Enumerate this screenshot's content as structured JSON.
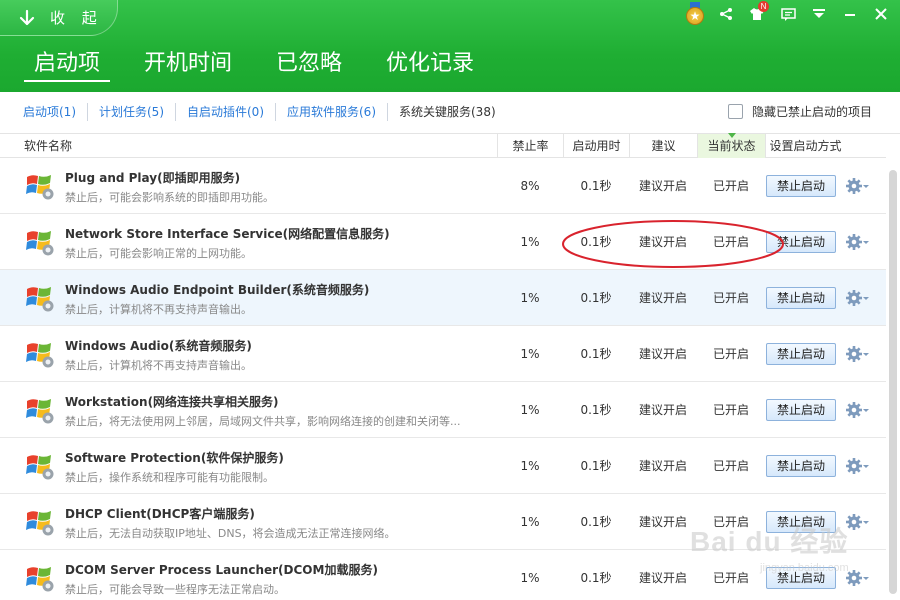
{
  "header": {
    "collapse_label": "收 起",
    "main_tabs": [
      {
        "label": "启动项"
      },
      {
        "label": "开机时间"
      },
      {
        "label": "已忽略"
      },
      {
        "label": "优化记录"
      }
    ],
    "notification_badge": "N",
    "accent_color": "#1fae33"
  },
  "subtabs": {
    "items": [
      {
        "label": "启动项(1)"
      },
      {
        "label": "计划任务(5)"
      },
      {
        "label": "自启动插件(0)"
      },
      {
        "label": "应用软件服务(6)"
      },
      {
        "label": "系统关键服务(38)"
      }
    ],
    "hide_disabled_label": "隐藏已禁止启动的项目"
  },
  "columns": {
    "name": "软件名称",
    "rate": "禁止率",
    "time": "启动用时",
    "advice": "建议",
    "status": "当前状态",
    "action": "设置启动方式"
  },
  "rows": [
    {
      "name": "Plug and Play(即插即用服务)",
      "desc": "禁止后，可能会影响系统的即插即用功能。",
      "rate": "8%",
      "time": "0.1秒",
      "advice": "建议开启",
      "status": "已开启",
      "action": "禁止启动"
    },
    {
      "name": "Network Store Interface Service(网络配置信息服务)",
      "desc": "禁止后，可能会影响正常的上网功能。",
      "rate": "1%",
      "time": "0.1秒",
      "advice": "建议开启",
      "status": "已开启",
      "action": "禁止启动"
    },
    {
      "name": "Windows Audio Endpoint Builder(系统音频服务)",
      "desc": "禁止后，计算机将不再支持声音输出。",
      "rate": "1%",
      "time": "0.1秒",
      "advice": "建议开启",
      "status": "已开启",
      "action": "禁止启动"
    },
    {
      "name": "Windows Audio(系统音频服务)",
      "desc": "禁止后，计算机将不再支持声音输出。",
      "rate": "1%",
      "time": "0.1秒",
      "advice": "建议开启",
      "status": "已开启",
      "action": "禁止启动"
    },
    {
      "name": "Workstation(网络连接共享相关服务)",
      "desc": "禁止后，将无法使用网上邻居，局域网文件共享，影响网络连接的创建和关闭等...",
      "rate": "1%",
      "time": "0.1秒",
      "advice": "建议开启",
      "status": "已开启",
      "action": "禁止启动"
    },
    {
      "name": "Software Protection(软件保护服务)",
      "desc": "禁止后，操作系统和程序可能有功能限制。",
      "rate": "1%",
      "time": "0.1秒",
      "advice": "建议开启",
      "status": "已开启",
      "action": "禁止启动"
    },
    {
      "name": "DHCP Client(DHCP客户端服务)",
      "desc": "禁止后，无法自动获取IP地址、DNS，将会造成无法正常连接网络。",
      "rate": "1%",
      "time": "0.1秒",
      "advice": "建议开启",
      "status": "已开启",
      "action": "禁止启动"
    },
    {
      "name": "DCOM Server Process Launcher(DCOM加载服务)",
      "desc": "禁止后，可能会导致一些程序无法正常启动。",
      "rate": "1%",
      "time": "0.1秒",
      "advice": "建议开启",
      "status": "已开启",
      "action": "禁止启动"
    }
  ],
  "watermark": {
    "main": "Bai du 经验",
    "sub": "jingyan.baidu.com"
  }
}
